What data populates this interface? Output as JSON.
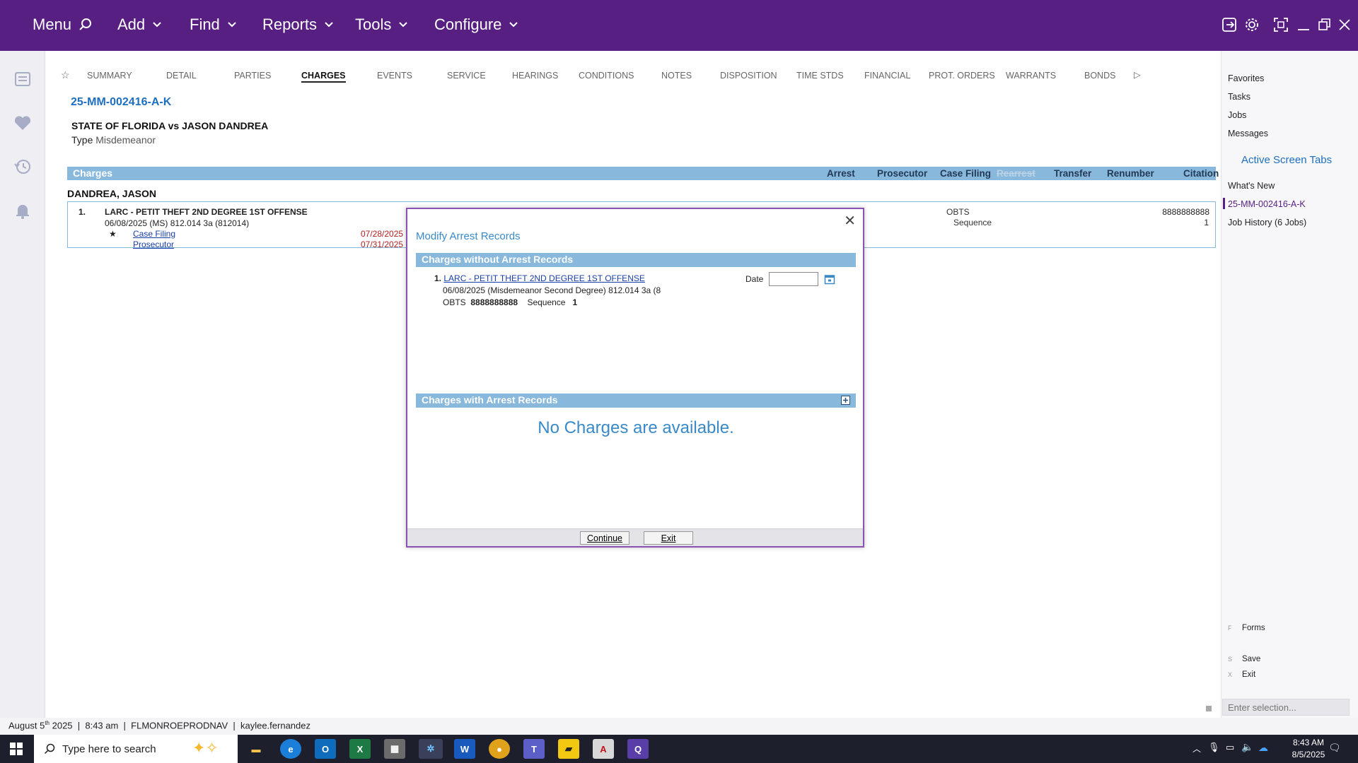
{
  "topnav": {
    "menu": "Menu",
    "add": "Add",
    "find": "Find",
    "reports": "Reports",
    "tools": "Tools",
    "configure": "Configure"
  },
  "tabs": [
    "SUMMARY",
    "DETAIL",
    "PARTIES",
    "CHARGES",
    "EVENTS",
    "SERVICE",
    "HEARINGS",
    "CONDITIONS",
    "NOTES",
    "DISPOSITION",
    "TIME STDS",
    "FINANCIAL",
    "PROT. ORDERS",
    "WARRANTS",
    "BONDS"
  ],
  "active_tab": "CHARGES",
  "case": {
    "number": "25-MM-002416-A-K",
    "caption": "STATE OF FLORIDA vs JASON DANDREA",
    "type_label": "Type",
    "type_value": "Misdemeanor"
  },
  "charges_bar": {
    "title": "Charges",
    "links": [
      "Arrest",
      "Prosecutor",
      "Case Filing",
      "Rearrest",
      "Transfer",
      "Renumber",
      "Citation"
    ],
    "disabled": [
      "Rearrest"
    ]
  },
  "party_name": "DANDREA, JASON",
  "charge": {
    "num": "1.",
    "title": "LARC - PETIT THEFT 2ND DEGREE 1ST OFFENSE",
    "detail": "06/08/2025  (MS) 812.014 3a (812014)",
    "star": "★",
    "case_filing": "Case Filing",
    "case_filing_date": "07/28/2025",
    "prosecutor": "Prosecutor",
    "prosecutor_date": "07/31/2025",
    "obts_label": "OBTS",
    "obts_value": "8888888888",
    "sequence_label": "Sequence",
    "sequence_value": "1"
  },
  "right_panel": {
    "favorites": "Favorites",
    "tasks": "Tasks",
    "jobs": "Jobs",
    "messages": "Messages",
    "active_tabs": "Active Screen Tabs",
    "whats_new": "What's New",
    "current_case": "25-MM-002416-A-K",
    "job_history": "Job History (6 Jobs)",
    "forms_key": "F",
    "forms": "Forms",
    "save_key": "S",
    "save": "Save",
    "exit_key": "X",
    "exit": "Exit",
    "selection_placeholder": "Enter selection..."
  },
  "modal": {
    "title": "Modify Arrest Records",
    "without_header": "Charges without Arrest Records",
    "charge_num": "1.",
    "charge_link": "LARC - PETIT THEFT 2ND DEGREE 1ST OFFENSE",
    "charge_detail": "06/08/2025  (Misdemeanor Second Degree)  812.014 3a (8",
    "obts_label": "OBTS",
    "obts_value": "8888888888",
    "sequence_label": "Sequence",
    "sequence_value": "1",
    "date_label": "Date",
    "date_value": "",
    "with_header": "Charges with Arrest Records",
    "no_charges": "No Charges are available.",
    "continue": "Continue",
    "exit": "Exit"
  },
  "status": {
    "date_day": "August 5",
    "date_sup": "th",
    "year_time": " 2025  |  8:43 am  |  FLMONROEPRODNAV  |  kaylee.fernandez"
  },
  "taskbar": {
    "search_placeholder": "Type here to search",
    "time": "8:43 AM",
    "date": "8/5/2025"
  }
}
